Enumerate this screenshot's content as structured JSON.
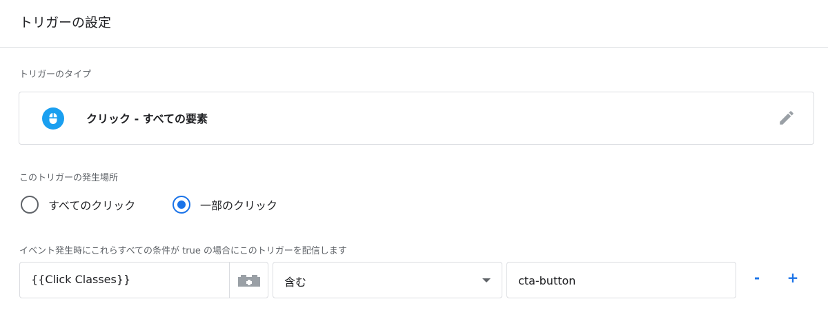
{
  "header": {
    "title": "トリガーの設定"
  },
  "trigger_type": {
    "label": "トリガーのタイプ",
    "name": "クリック - すべての要素",
    "icon": "mouse-icon",
    "icon_color": "#1a9ff0",
    "edit_icon": "pencil-icon"
  },
  "fires_on": {
    "label": "このトリガーの発生場所",
    "options": [
      {
        "label": "すべてのクリック",
        "selected": false
      },
      {
        "label": "一部のクリック",
        "selected": true
      }
    ],
    "accent": "#1a73e8"
  },
  "condition": {
    "label": "イベント発生時にこれらすべての条件が true の場合にこのトリガーを配信します",
    "variable": "{{Click Classes}}",
    "variable_picker_icon": "lego-block-icon",
    "operator": "含む",
    "value": "cta-button",
    "remove_label": "-",
    "add_label": "+"
  }
}
